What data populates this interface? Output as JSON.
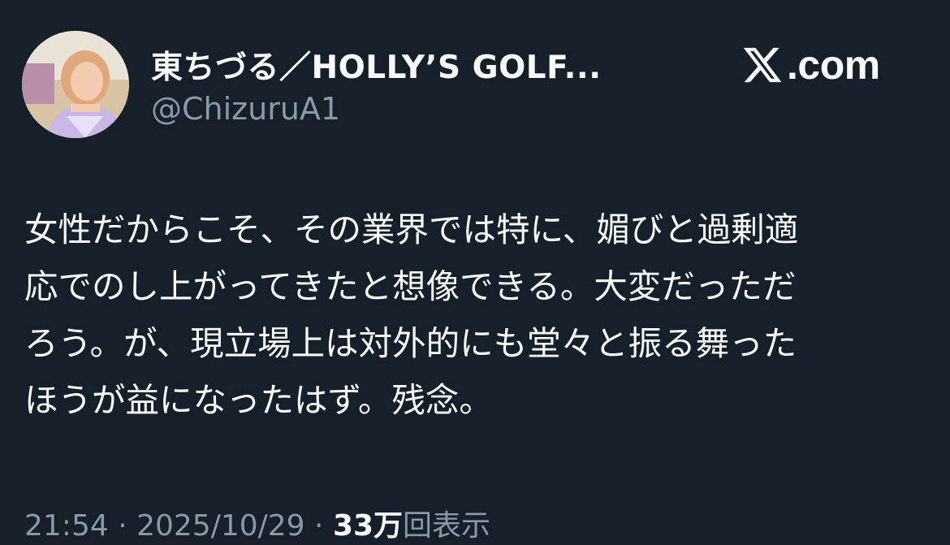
{
  "author": {
    "display_name": "東ちづる／HOLLY’S GOLF...",
    "handle": "@ChizuruA1"
  },
  "brand": {
    "icon": "x-logo-icon",
    "domain": ".com"
  },
  "post": {
    "lines": [
      "女性だからこそ、その業界では特に、媚びと過剰適",
      "応でのし上がってきたと想像できる。大変だっただ",
      "ろう。が、現立場上は対外的にも堂々と振る舞った",
      "ほうが益になったはず。残念。"
    ]
  },
  "meta": {
    "time": "21:54",
    "separator": " · ",
    "date": "2025/10/29",
    "views_count": "33万",
    "views_label": "回表示"
  },
  "colors": {
    "background": "#15202b",
    "primary_text": "#f7f9f9",
    "secondary_text": "#8b98a5"
  }
}
